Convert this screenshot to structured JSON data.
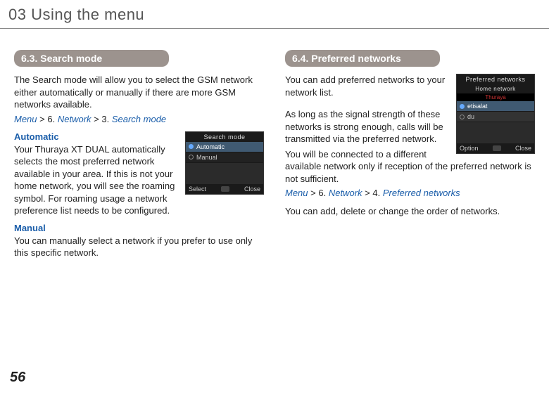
{
  "page_title": "03 Using the menu",
  "page_number": "56",
  "left": {
    "heading": "6.3. Search mode",
    "intro": "The Search mode will allow you to select the GSM network either automatically or manually if there are more GSM networks available.",
    "path": {
      "menu": "Menu",
      "n1": "6.",
      "p1": "Network",
      "n2": "3.",
      "p2": "Search mode"
    },
    "automatic": {
      "title": "Automatic",
      "body": "Your Thuraya XT DUAL automatically selects the most preferred network available in your area. If this is not your home network, you will see the roaming symbol. For roaming usage a network preference list needs to be configured."
    },
    "manual": {
      "title": "Manual",
      "body": "You can manually select a network if you prefer to use only this specific network."
    },
    "phone": {
      "title": "Search mode",
      "opt1": "Automatic",
      "opt2": "Manual",
      "soft_left": "Select",
      "soft_right": "Close"
    }
  },
  "right": {
    "heading": "6.4. Preferred networks",
    "intro1": "You can add preferred networks to your network list.",
    "intro2": "As long as the signal strength of these networks is strong enough, calls will be transmitted via the preferred network.",
    "intro3": "You will be connected to a different available network only if reception of the preferred network is not sufficient.",
    "path": {
      "menu": "Menu",
      "n1": "6.",
      "p1": "Network",
      "n2": "4.",
      "p2": "Preferred networks"
    },
    "outro": "You can add, delete or change the order of networks.",
    "phone": {
      "title": "Preferred networks",
      "sub": "Home network",
      "redsub": "Thuraya",
      "row1": "etisalat",
      "row2": "du",
      "soft_left": "Option",
      "soft_right": "Close"
    }
  }
}
